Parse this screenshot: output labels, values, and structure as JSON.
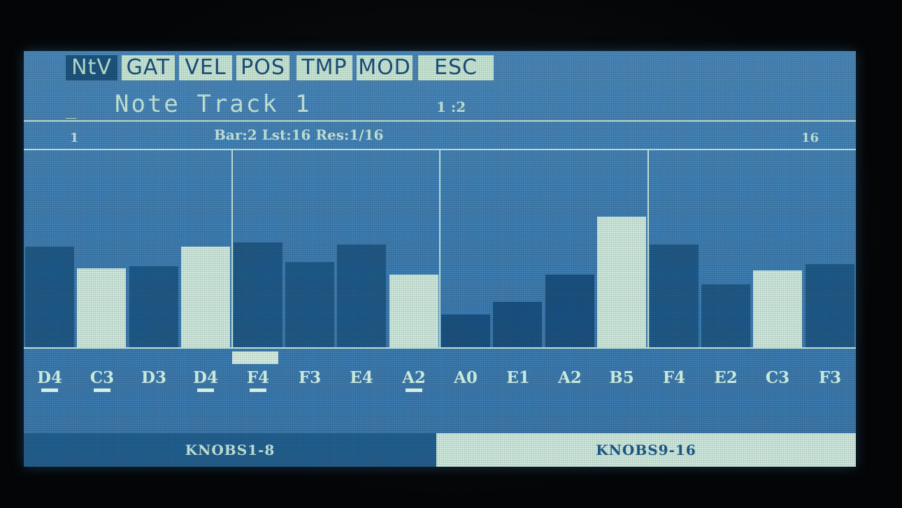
{
  "menu": {
    "tabs": [
      {
        "label": "NtV",
        "active": true
      },
      {
        "label": "GAT",
        "active": false
      },
      {
        "label": "VEL",
        "active": false
      },
      {
        "label": "POS",
        "active": false
      },
      {
        "label": "TMP",
        "active": false
      },
      {
        "label": "MOD",
        "active": false
      },
      {
        "label": "ESC",
        "active": false
      }
    ]
  },
  "header": {
    "cursor": "_",
    "title": "Note Track  1",
    "position": "1 :2"
  },
  "info": {
    "step_first": "1",
    "bar_info": "Bar:2 Lst:16 Res:1/16",
    "step_last": "16"
  },
  "steps": [
    {
      "note": "D4",
      "level": 0.51,
      "style": "dark",
      "underline": true
    },
    {
      "note": "C3",
      "level": 0.4,
      "style": "light",
      "underline": true
    },
    {
      "note": "D3",
      "level": 0.41,
      "style": "dark",
      "underline": false
    },
    {
      "note": "D4",
      "level": 0.51,
      "style": "light",
      "underline": true
    },
    {
      "note": "F4",
      "level": 0.53,
      "style": "dark",
      "underline": true
    },
    {
      "note": "F3",
      "level": 0.43,
      "style": "dark",
      "underline": false
    },
    {
      "note": "E4",
      "level": 0.52,
      "style": "dark",
      "underline": false
    },
    {
      "note": "A2",
      "level": 0.37,
      "style": "light",
      "underline": true
    },
    {
      "note": "A0",
      "level": 0.17,
      "style": "mid",
      "underline": false
    },
    {
      "note": "E1",
      "level": 0.23,
      "style": "mid",
      "underline": false
    },
    {
      "note": "A2",
      "level": 0.37,
      "style": "mid",
      "underline": false
    },
    {
      "note": "B5",
      "level": 0.66,
      "style": "light",
      "underline": false
    },
    {
      "note": "F4",
      "level": 0.52,
      "style": "dark",
      "underline": false
    },
    {
      "note": "E2",
      "level": 0.32,
      "style": "dark",
      "underline": false
    },
    {
      "note": "C3",
      "level": 0.39,
      "style": "light",
      "underline": false
    },
    {
      "note": "F3",
      "level": 0.42,
      "style": "dark",
      "underline": false
    }
  ],
  "selected_step": 5,
  "knobs": {
    "left_label": "KNOBS1-8",
    "right_label": "KNOBS9-16"
  },
  "colors": {
    "screen": "#3f7fb3",
    "text": "#c8e8dc",
    "bar_dark": "#1f5a89",
    "bar_light": "#cfeade"
  }
}
